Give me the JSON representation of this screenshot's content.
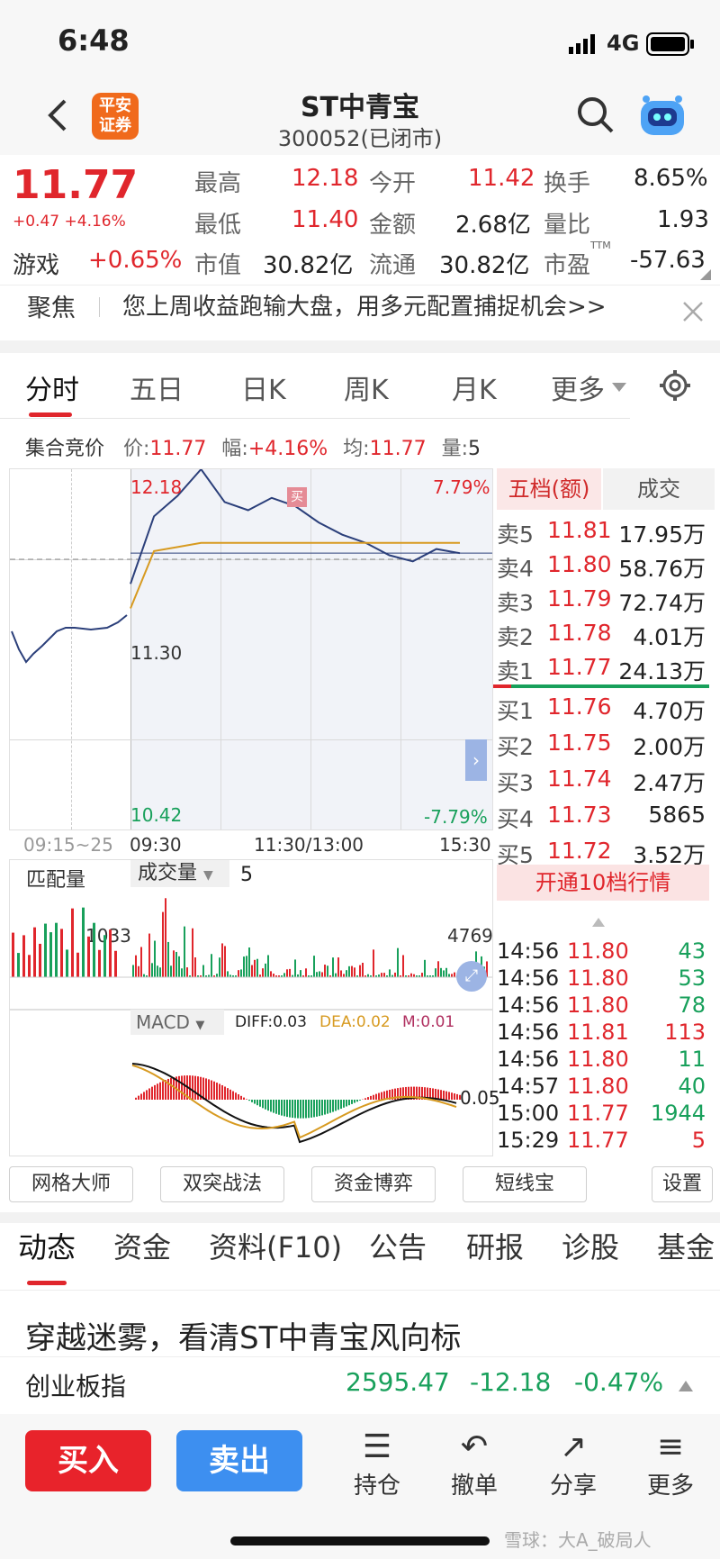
{
  "status": {
    "time": "6:48",
    "network": "4G"
  },
  "nav": {
    "logo_line1": "平安",
    "logo_line2": "证券",
    "title": "ST中青宝",
    "subtitle": "300052(已闭市)"
  },
  "quote": {
    "price": "11.77",
    "change": "+0.47",
    "change_pct": "+4.16%",
    "high_label": "最高",
    "high": "12.18",
    "open_label": "今开",
    "open": "11.42",
    "turnover_label": "换手",
    "turnover": "8.65%",
    "low_label": "最低",
    "low": "11.40",
    "amount_label": "金额",
    "amount": "2.68亿",
    "vol_ratio_label": "量比",
    "vol_ratio": "1.93",
    "sector": "游戏",
    "sector_change": "+0.65%",
    "mktcap_label": "市值",
    "mktcap": "30.82亿",
    "float_label": "流通",
    "float": "30.82亿",
    "pe_label": "市盈",
    "pe_sup": "TTM",
    "pe": "-57.63"
  },
  "focus": {
    "label": "聚焦",
    "text": "您上周收益跑输大盘，用多元配置捕捉机会>>"
  },
  "tabs": [
    "分时",
    "五日",
    "日K",
    "周K",
    "月K",
    "更多"
  ],
  "auction": {
    "label": "集合竞价",
    "price_l": "价:",
    "price": "11.77",
    "range_l": "幅:",
    "range": "+4.16%",
    "avg_l": "均:",
    "avg": "11.77",
    "vol_l": "量:",
    "vol": "5"
  },
  "chart": {
    "y_top": "12.18",
    "y_mid": "11.30",
    "y_bot": "10.42",
    "pct_top": "7.79%",
    "pct_bot": "-7.79%",
    "x_pre": "09:15~25",
    "x_start": "09:30",
    "x_mid": "11:30/13:00",
    "x_end": "15:30",
    "buy_marker": "买",
    "vol_label1": "匹配量",
    "vol_label2": "成交量",
    "vol_value": "5",
    "vol_left": "1033",
    "vol_right": "4769",
    "macd_label": "MACD",
    "diff": "DIFF:0.03",
    "dea": "DEA:0.02",
    "m": "M:0.01",
    "macd_axis": "0.05"
  },
  "chart_data": {
    "type": "line",
    "title": "",
    "ylim": [
      10.42,
      12.18
    ],
    "x": [
      "09:30",
      "11:30/13:00",
      "15:30"
    ],
    "series": [
      {
        "values": [
          11.62,
          11.95,
          12.05,
          12.18,
          12.02,
          11.98,
          12.04,
          12.0,
          11.92,
          11.86,
          11.82,
          11.76,
          11.73,
          11.79,
          11.77
        ]
      },
      {
        "values": [
          11.5,
          11.78,
          11.8,
          11.82,
          11.82,
          11.82,
          11.82,
          11.82,
          11.82,
          11.82,
          11.82,
          11.82,
          11.82,
          11.82,
          11.82
        ]
      }
    ]
  },
  "orderbook": {
    "tab1": "五档(额)",
    "tab2": "成交",
    "asks": [
      {
        "label": "卖5",
        "price": "11.81",
        "amount": "17.95万"
      },
      {
        "label": "卖4",
        "price": "11.80",
        "amount": "58.76万"
      },
      {
        "label": "卖3",
        "price": "11.79",
        "amount": "72.74万"
      },
      {
        "label": "卖2",
        "price": "11.78",
        "amount": "4.01万"
      },
      {
        "label": "卖1",
        "price": "11.77",
        "amount": "24.13万"
      }
    ],
    "bids": [
      {
        "label": "买1",
        "price": "11.76",
        "amount": "4.70万"
      },
      {
        "label": "买2",
        "price": "11.75",
        "amount": "2.00万"
      },
      {
        "label": "买3",
        "price": "11.74",
        "amount": "2.47万"
      },
      {
        "label": "买4",
        "price": "11.73",
        "amount": "5865"
      },
      {
        "label": "买5",
        "price": "11.72",
        "amount": "3.52万"
      }
    ],
    "open10": "开通10档行情"
  },
  "ticks": [
    {
      "t": "14:56",
      "p": "11.80",
      "v": "43",
      "c": "green"
    },
    {
      "t": "14:56",
      "p": "11.80",
      "v": "53",
      "c": "green"
    },
    {
      "t": "14:56",
      "p": "11.80",
      "v": "78",
      "c": "green"
    },
    {
      "t": "14:56",
      "p": "11.81",
      "v": "113",
      "c": "red"
    },
    {
      "t": "14:56",
      "p": "11.80",
      "v": "11",
      "c": "green"
    },
    {
      "t": "14:57",
      "p": "11.80",
      "v": "40",
      "c": "green"
    },
    {
      "t": "15:00",
      "p": "11.77",
      "v": "1944",
      "c": "green"
    },
    {
      "t": "15:29",
      "p": "11.77",
      "v": "5",
      "c": "red"
    }
  ],
  "tools": [
    "网格大师",
    "双突战法",
    "资金博弈",
    "短线宝",
    "设置"
  ],
  "bottom_tabs": [
    "动态",
    "资金",
    "资料(F10)",
    "公告",
    "研报",
    "诊股",
    "基金"
  ],
  "headline": "穿越迷雾，看清ST中青宝风向标",
  "index": {
    "name": "创业板指",
    "value": "2595.47",
    "change": "-12.18",
    "pct": "-0.47%"
  },
  "actions": {
    "buy": "买入",
    "sell": "卖出",
    "hold": "持仓",
    "cancel": "撤单",
    "share": "分享",
    "more": "更多"
  },
  "watermark": "雪球：大A_破局人",
  "colors": {
    "up": "#e0262c",
    "down": "#18a05b",
    "line": "#2b3f7a",
    "avg": "#d79a20",
    "buy_btn": "#e8232b",
    "sell_btn": "#3d8ff0"
  }
}
